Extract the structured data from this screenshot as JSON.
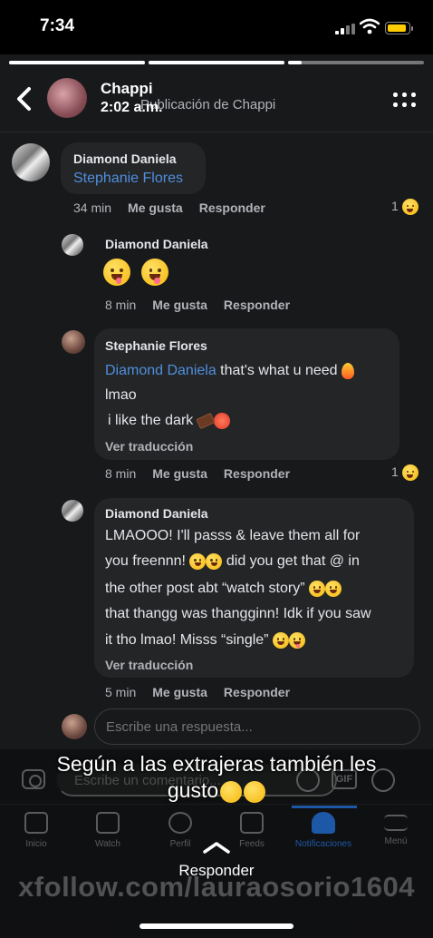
{
  "status_bar": {
    "time": "7:34"
  },
  "story": {
    "progress": [
      1.0,
      1.0,
      0.1
    ],
    "author": "Chappi",
    "time": "2:02 a.m.",
    "post_title": "Publicación de Chappi"
  },
  "comments": [
    {
      "author": "Diamond Daniela",
      "text_mention": "Stephanie Flores",
      "age": "34 min",
      "like": "Me gusta",
      "reply": "Responder",
      "reaction_count": "1"
    },
    {
      "author": "Diamond Daniela",
      "emoji": [
        "zany-face-emoji",
        "zany-face-emoji"
      ],
      "age": "8 min",
      "like": "Me gusta",
      "reply": "Responder"
    },
    {
      "author": "Stephanie Flores",
      "mention": "Diamond Daniela",
      "line1": " that's what u need",
      "line2": "lmao",
      "line3": "i like the dark",
      "translate": "Ver traducción",
      "age": "8 min",
      "like": "Me gusta",
      "reply": "Responder",
      "reaction_count": "1"
    },
    {
      "author": "Diamond Daniela",
      "lines": [
        "LMAOOO! I'll passs & leave them all for",
        "you freennn!",
        "did you get that @ in",
        "the other post abt “watch story”",
        "that thangg was thangginn! Idk if you saw",
        "it tho lmao! Misss “single”"
      ],
      "translate": "Ver traducción",
      "age": "5 min",
      "like": "Me gusta",
      "reply": "Responder"
    }
  ],
  "reply_box": {
    "placeholder": "Escribe una respuesta..."
  },
  "comment_bar": {
    "placeholder": "Escribe un comentario..."
  },
  "nav": [
    {
      "label": "Inicio",
      "icon": "home-icon"
    },
    {
      "label": "Watch",
      "icon": "watch-icon"
    },
    {
      "label": "Perfil",
      "icon": "profile-icon"
    },
    {
      "label": "Feeds",
      "icon": "feeds-icon"
    },
    {
      "label": "Notificaciones",
      "icon": "bell-icon",
      "active": true
    },
    {
      "label": "Menú",
      "icon": "menu-icon"
    }
  ],
  "caption": {
    "line1": "Según a las extrajeras también les",
    "line2": "gusto"
  },
  "bottom": {
    "action": "Responder",
    "watermark": "xfollow.com/lauraosorio1604"
  },
  "colors": {
    "background": "#18191b",
    "bubble": "#242526",
    "mention": "#4e8fe0",
    "accent": "#2d88ff",
    "muted": "#b0b3b8"
  }
}
